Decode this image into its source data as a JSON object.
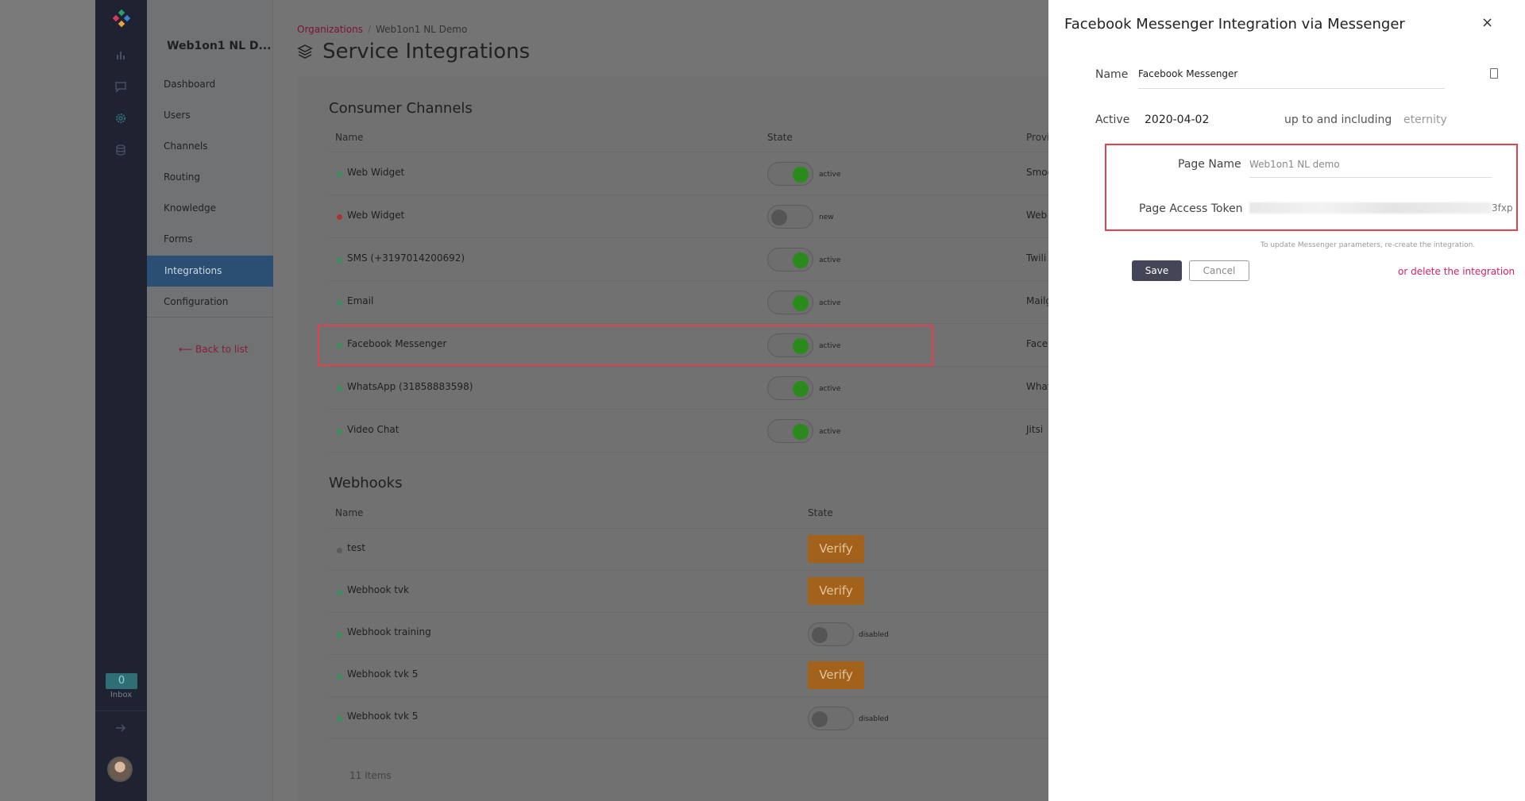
{
  "rail": {
    "inbox_count": "0",
    "inbox_label": "Inbox"
  },
  "nav": {
    "org_name": "Web1on1 NL D...",
    "items": [
      "Dashboard",
      "Users",
      "Channels",
      "Routing",
      "Knowledge",
      "Forms",
      "Integrations",
      "Configuration"
    ],
    "active_item": "Integrations",
    "back_label": "Back to list"
  },
  "breadcrumb": {
    "root": "Organizations",
    "current": "Web1on1 NL Demo"
  },
  "page_title": "Service Integrations",
  "consumer_channels": {
    "title": "Consumer Channels",
    "col_name": "Name",
    "col_state": "State",
    "col_provider": "Provi",
    "rows": [
      {
        "name": "Web Widget",
        "state": "active",
        "provider": "Smoo"
      },
      {
        "name": "Web Widget",
        "state": "new",
        "provider": "Web"
      },
      {
        "name": "SMS (+3197014200692)",
        "state": "active",
        "provider": "Twili"
      },
      {
        "name": "Email",
        "state": "active",
        "provider": "Mailg"
      },
      {
        "name": "Facebook Messenger",
        "state": "active",
        "provider": "Facel"
      },
      {
        "name": "WhatsApp (31858883598)",
        "state": "active",
        "provider": "What"
      },
      {
        "name": "Video Chat",
        "state": "active",
        "provider": "Jitsi"
      }
    ]
  },
  "webhooks": {
    "title": "Webhooks",
    "col_name": "Name",
    "col_state": "State",
    "verify_label": "Verify",
    "rows": [
      {
        "name": "test",
        "state": "verify"
      },
      {
        "name": "Webhook tvk",
        "state": "verify"
      },
      {
        "name": "Webhook training",
        "state": "disabled"
      },
      {
        "name": "Webhook tvk 5",
        "state": "verify"
      },
      {
        "name": "Webhook tvk 5",
        "state": "disabled"
      }
    ],
    "items_count": "11 Items"
  },
  "panel": {
    "title": "Facebook Messenger Integration via Messenger",
    "close": "×",
    "name_label": "Name",
    "name_value": "Facebook Messenger",
    "active_label": "Active",
    "active_from": "2020-04-02",
    "up_to_label": "up to and including",
    "active_to_placeholder": "eternity",
    "page_name_label": "Page Name",
    "page_name_value": "Web1on1 NL demo",
    "token_label": "Page Access Token",
    "token_suffix": "3fxp",
    "hint": "To update Messenger parameters, re-create the integration.",
    "save_label": "Save",
    "cancel_label": "Cancel",
    "delete_label": "or delete the integration"
  },
  "colors": {
    "highlight": "#e0424f",
    "toggle_on": "#2a8a1c",
    "verify": "#a3621b",
    "delete_link": "#d21f6a",
    "save_button": "#444556"
  }
}
